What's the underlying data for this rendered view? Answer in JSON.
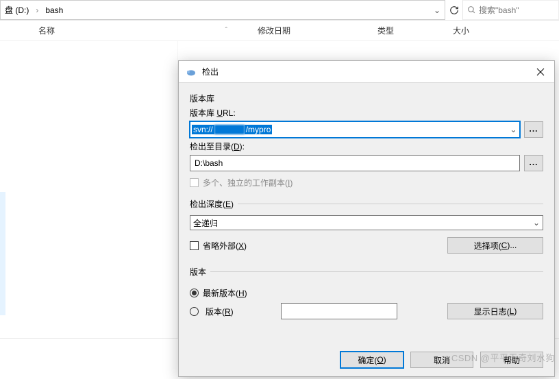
{
  "explorer": {
    "breadcrumb": {
      "drive": "盘 (D:)",
      "folder": "bash"
    },
    "search_placeholder": "搜索\"bash\"",
    "columns": {
      "name": "名称",
      "modified": "修改日期",
      "type": "类型",
      "size": "大小"
    }
  },
  "dialog": {
    "title": "检出",
    "repo_group": "版本库",
    "url_label_pre": "版本库 ",
    "url_u": "U",
    "url_label_post": "RL:",
    "url_value_prefix": "svn://",
    "url_value_blur": "            ",
    "url_value_suffix": "/mypro",
    "checkout_dir_pre": "检出至目录(",
    "checkout_dir_u": "D",
    "checkout_dir_post": "):",
    "checkout_dir_value": "D:\\bash",
    "multi_wc_pre": "多个、独立的工作副本(",
    "multi_wc_u": "I",
    "multi_wc_post": ")",
    "depth_legend_pre": "检出深度(",
    "depth_u": "E",
    "depth_legend_post": ")",
    "depth_value": "全递归",
    "omit_ext_pre": "省略外部(",
    "omit_ext_u": "X",
    "omit_ext_post": ")",
    "choose_pre": "选择项(",
    "choose_u": "C",
    "choose_post": ")...",
    "rev_legend": "版本",
    "rev_head_pre": "最新版本(",
    "rev_head_u": "H",
    "rev_head_post": ")",
    "rev_num_pre": "版本(",
    "rev_num_u": "R",
    "rev_num_post": ")",
    "rev_num_value": "",
    "showlog_pre": "显示日志(",
    "showlog_u": "L",
    "showlog_post": ")",
    "ok_pre": "确定(",
    "ok_u": "O",
    "ok_post": ")",
    "cancel": "取消",
    "help": "帮助"
  },
  "watermark": "CSDN @平平无奇刘水狗"
}
